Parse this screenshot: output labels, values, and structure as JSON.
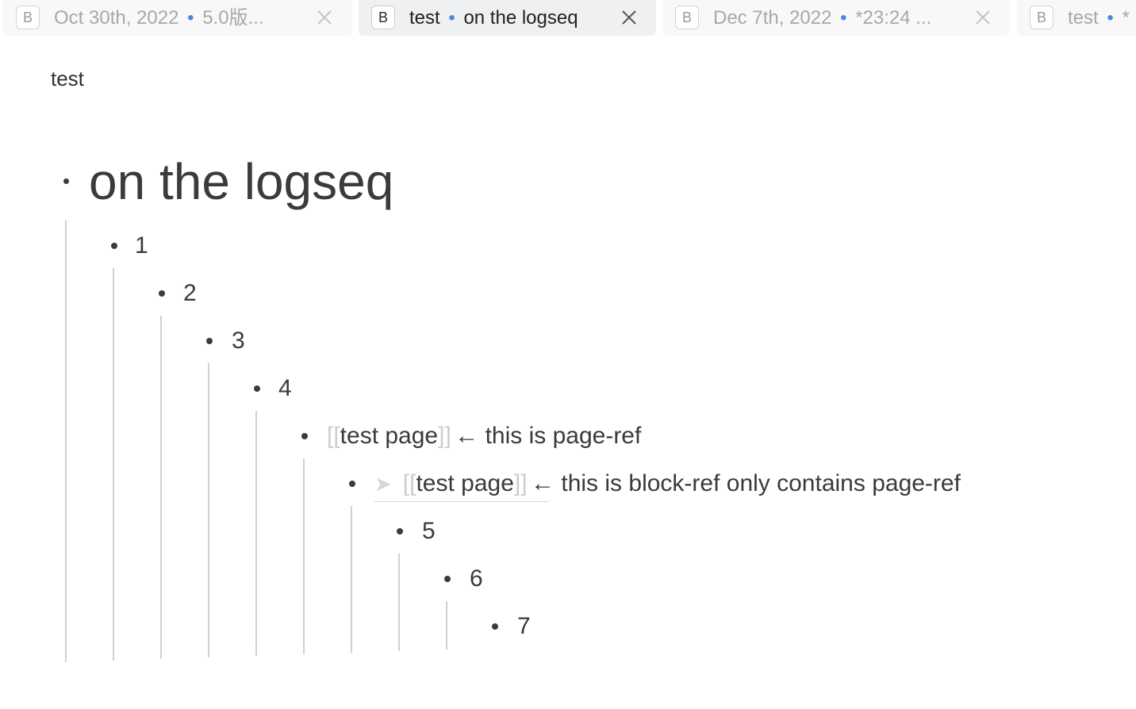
{
  "tabs": [
    {
      "title": "Oct 30th, 2022",
      "sep": "•",
      "subtitle": "5.0版...",
      "icon": "B",
      "active": false,
      "has_close": true
    },
    {
      "title": "test",
      "sep": "•",
      "subtitle": "on the logseq",
      "icon": "B",
      "active": true,
      "has_close": true
    },
    {
      "title": "Dec 7th, 2022",
      "sep": "•",
      "subtitle": "*23:24 ...",
      "icon": "B",
      "active": false,
      "has_close": true
    },
    {
      "title": "test",
      "sep": "•",
      "subtitle": "*",
      "icon": "B",
      "active": false,
      "has_close": false
    }
  ],
  "page": {
    "title": "test"
  },
  "blocks": {
    "heading": "on the logseq",
    "b1": "1",
    "b2": "2",
    "b3": "3",
    "b4": "4",
    "b5_open": "[[",
    "b5_ref": "test page",
    "b5_close": "]]",
    "b5_suffix": "← this is page-ref",
    "b6_arrow": "➤",
    "b6_open": "[[",
    "b6_ref": "test page",
    "b6_close": "]]",
    "b6_suffix": "← this is block-ref only contains page-ref",
    "b7": "5",
    "b8": "6",
    "b9": "7"
  },
  "colors": {
    "tab_separator": "#4a86e8",
    "guide_line": "#c9d2da",
    "bullet": "#3f3a36"
  }
}
